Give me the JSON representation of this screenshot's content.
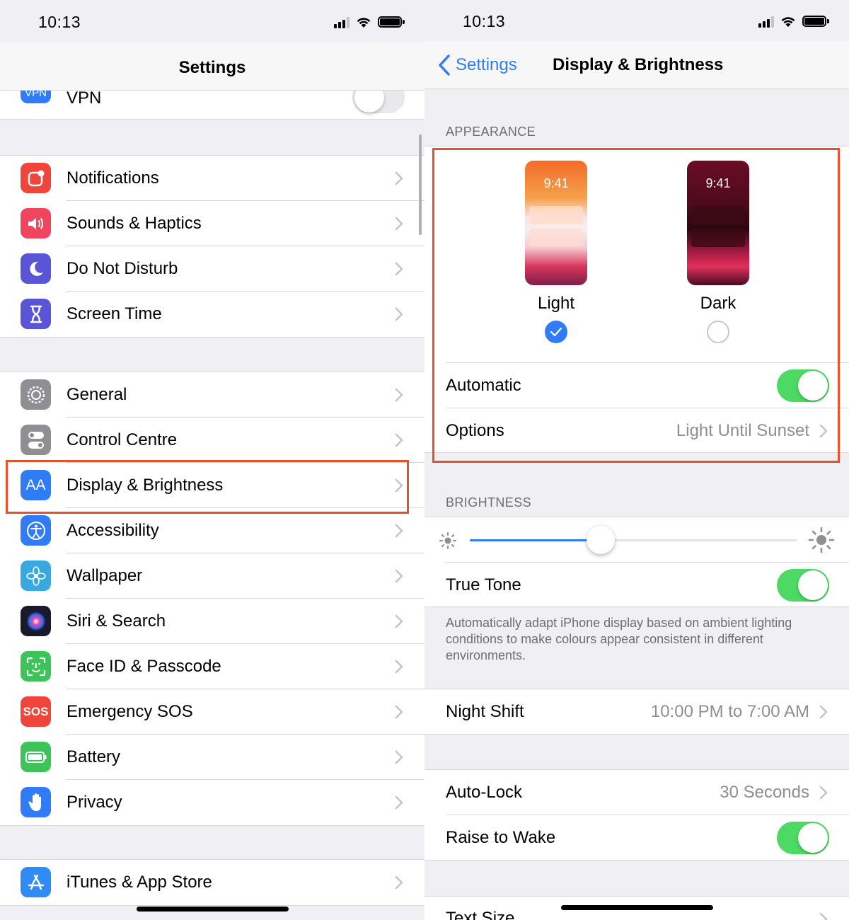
{
  "left": {
    "status": {
      "time": "10:13"
    },
    "nav_title": "Settings",
    "vpn": {
      "label": "VPN",
      "icon_text": "VPN",
      "toggle": "off"
    },
    "group1": [
      {
        "id": "notifications",
        "label": "Notifications",
        "icon": "notifications-icon",
        "color": "#f0453a"
      },
      {
        "id": "sounds",
        "label": "Sounds & Haptics",
        "icon": "speaker-icon",
        "color": "#f0445f"
      },
      {
        "id": "dnd",
        "label": "Do Not Disturb",
        "icon": "moon-icon",
        "color": "#5a55d6"
      },
      {
        "id": "screentime",
        "label": "Screen Time",
        "icon": "hourglass-icon",
        "color": "#5a55d6"
      }
    ],
    "group2": [
      {
        "id": "general",
        "label": "General",
        "icon": "gear-icon",
        "color": "#8e8e93"
      },
      {
        "id": "control",
        "label": "Control Centre",
        "icon": "toggles-icon",
        "color": "#8e8e93"
      },
      {
        "id": "display",
        "label": "Display & Brightness",
        "icon": "text-size-icon",
        "icon_text": "AA",
        "color": "#2f7cf6"
      },
      {
        "id": "accessibility",
        "label": "Accessibility",
        "icon": "accessibility-icon",
        "color": "#2f7cf6"
      },
      {
        "id": "wallpaper",
        "label": "Wallpaper",
        "icon": "flower-icon",
        "color": "#36a9e0"
      },
      {
        "id": "siri",
        "label": "Siri & Search",
        "icon": "siri-icon",
        "color": "#1a1a2e"
      },
      {
        "id": "faceid",
        "label": "Face ID & Passcode",
        "icon": "face-id-icon",
        "color": "#3cc45b"
      },
      {
        "id": "sos",
        "label": "Emergency SOS",
        "icon": "sos-icon",
        "icon_text": "SOS",
        "color": "#f0453a"
      },
      {
        "id": "battery",
        "label": "Battery",
        "icon": "battery-icon",
        "color": "#3cc45b"
      },
      {
        "id": "privacy",
        "label": "Privacy",
        "icon": "hand-icon",
        "color": "#2f7cf6"
      }
    ],
    "group3": [
      {
        "id": "appstore",
        "label": "iTunes & App Store",
        "icon": "app-store-icon",
        "color": "#2f8cf6"
      }
    ]
  },
  "right": {
    "status": {
      "time": "10:13"
    },
    "back_label": "Settings",
    "nav_title": "Display & Brightness",
    "appearance_header": "APPEARANCE",
    "light": {
      "label": "Light",
      "preview_time": "9:41",
      "selected": true
    },
    "dark": {
      "label": "Dark",
      "preview_time": "9:41",
      "selected": false
    },
    "automatic": {
      "label": "Automatic",
      "toggle": "on"
    },
    "options": {
      "label": "Options",
      "value": "Light Until Sunset"
    },
    "brightness_header": "BRIGHTNESS",
    "brightness_level": 0.4,
    "true_tone": {
      "label": "True Tone",
      "toggle": "on"
    },
    "true_tone_desc": "Automatically adapt iPhone display based on ambient lighting conditions to make colours appear consistent in different environments.",
    "night_shift": {
      "label": "Night Shift",
      "value": "10:00 PM to 7:00 AM"
    },
    "auto_lock": {
      "label": "Auto-Lock",
      "value": "30 Seconds"
    },
    "raise_to_wake": {
      "label": "Raise to Wake",
      "toggle": "on"
    },
    "text_size": {
      "label": "Text Size"
    }
  },
  "colors": {
    "accent": "#2f7cf6",
    "highlight": "#e0532f",
    "toggle_on": "#4cd964"
  }
}
